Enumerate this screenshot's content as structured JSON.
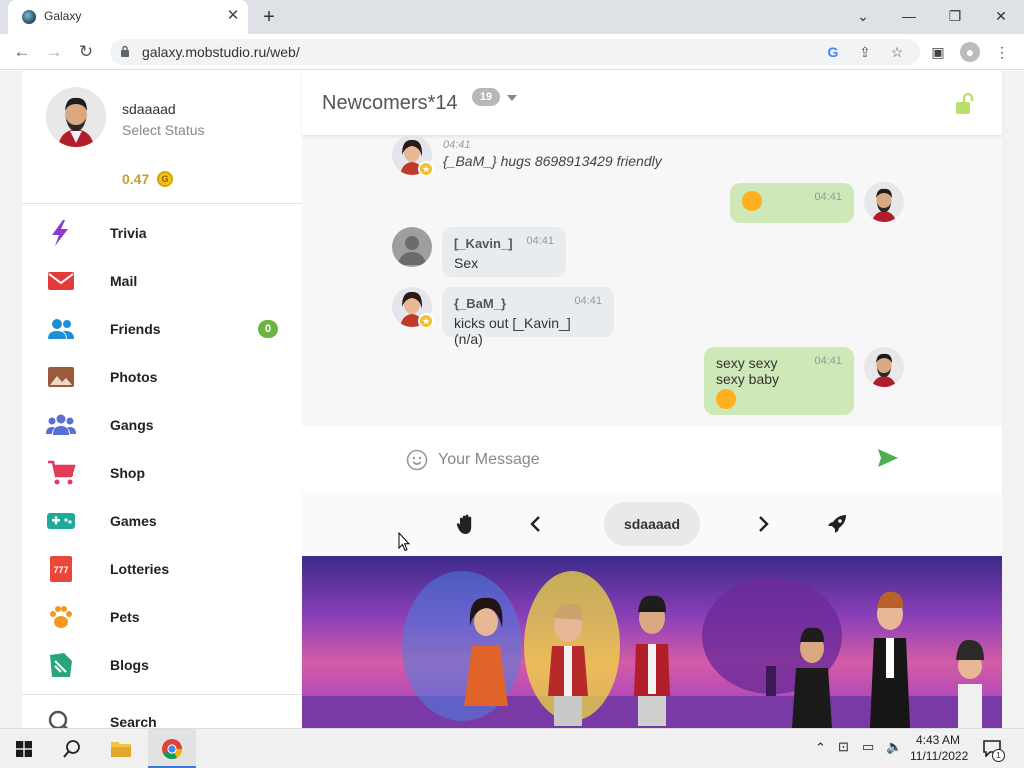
{
  "browser": {
    "tab_title": "Galaxy",
    "url": "galaxy.mobstudio.ru/web/"
  },
  "sidebar": {
    "username": "sdaaaad",
    "status": "Select Status",
    "balance": "0.47",
    "coin_symbol": "G",
    "items": [
      {
        "label": "Trivia",
        "icon": "lightning-icon"
      },
      {
        "label": "Mail",
        "icon": "mail-icon"
      },
      {
        "label": "Friends",
        "icon": "friends-icon",
        "badge": "0"
      },
      {
        "label": "Photos",
        "icon": "photos-icon"
      },
      {
        "label": "Gangs",
        "icon": "gangs-icon"
      },
      {
        "label": "Shop",
        "icon": "cart-icon"
      },
      {
        "label": "Games",
        "icon": "gamepad-icon"
      },
      {
        "label": "Lotteries",
        "icon": "ticket-icon"
      },
      {
        "label": "Pets",
        "icon": "paw-icon"
      },
      {
        "label": "Blogs",
        "icon": "blog-icon"
      },
      {
        "label": "Search",
        "icon": "search-icon"
      }
    ]
  },
  "chat": {
    "room_title": "Newcomers*14",
    "room_count": "19",
    "messages": [
      {
        "type": "action",
        "time": "04:41",
        "text": "{_BaM_} hugs 8698913429 friendly"
      },
      {
        "type": "outgoing",
        "time": "04:41",
        "emoji": "tongue-emoji"
      },
      {
        "type": "incoming",
        "sender": "[_Kavin_]",
        "time": "04:41",
        "text": "Sex"
      },
      {
        "type": "incoming",
        "sender": "{_BaM_}",
        "time": "04:41",
        "text": "kicks out [_Kavin_] (n/a)"
      },
      {
        "type": "outgoing",
        "time": "04:41",
        "lines": [
          "sexy sexy",
          "sexy baby"
        ],
        "emoji": "tongue-emoji"
      }
    ],
    "input_placeholder": "Your Message",
    "current_user": "sdaaaad"
  },
  "taskbar": {
    "time": "4:43 AM",
    "date": "11/11/2022",
    "notification_count": "1"
  },
  "colors": {
    "accent_green": "#4caf50",
    "outgoing_bubble": "#cfe8b7",
    "incoming_bubble": "#e9ecef",
    "badge_green": "#6cb33f",
    "coin_gold": "#c7a02a"
  }
}
